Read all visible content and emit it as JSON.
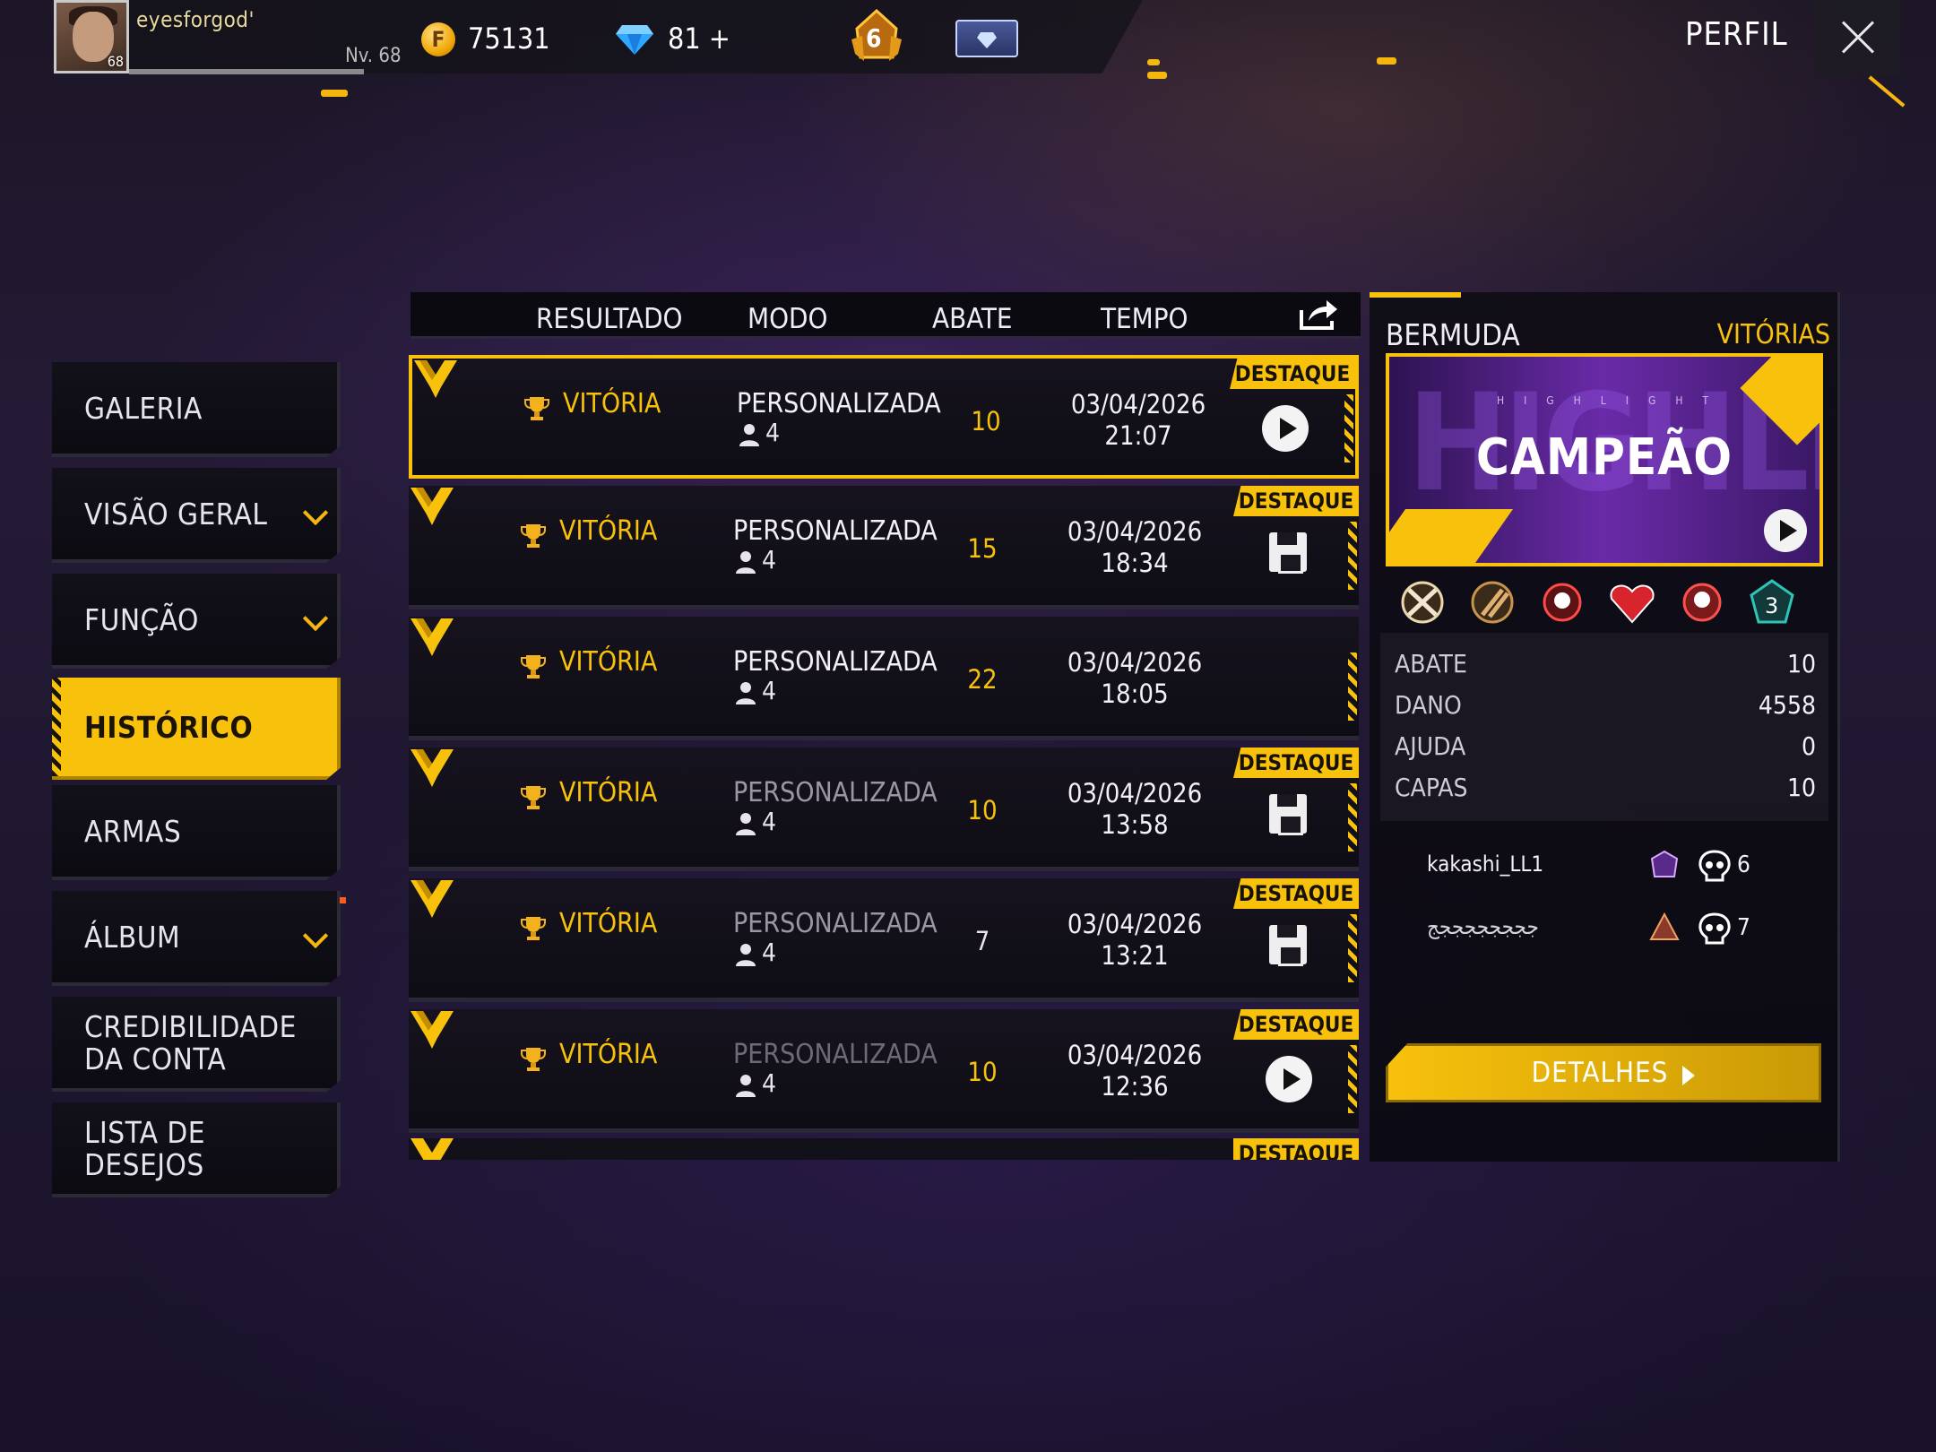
{
  "header": {
    "username": "eyesforgod'",
    "avatar_level": "68",
    "level_label": "Nv. 68",
    "gold_icon": "F",
    "gold": "75131",
    "diamonds": "81",
    "diamonds_plus": "+",
    "rank_number": "6",
    "title": "PERFIL"
  },
  "sidebar": {
    "items": [
      {
        "label": "GALERIA"
      },
      {
        "label": "VISÃO GERAL"
      },
      {
        "label": "FUNÇÃO"
      },
      {
        "label": "HISTÓRICO",
        "active": true
      },
      {
        "label": "ARMAS"
      },
      {
        "label": "ÁLBUM"
      },
      {
        "label": "CREDIBILIDADE DA CONTA"
      },
      {
        "label": "LISTA DE DESEJOS"
      }
    ]
  },
  "table": {
    "columns": [
      "RESULTADO",
      "MODO",
      "ABATE",
      "TEMPO"
    ],
    "rows": [
      {
        "result": "VITÓRIA",
        "mode": "PERSONALIZADA",
        "players": "4",
        "kills": "10",
        "date": "03/04/2026",
        "time": "21:07",
        "badge": "DESTAQUE",
        "action": "play-icon"
      },
      {
        "result": "VITÓRIA",
        "mode": "PERSONALIZADA",
        "players": "4",
        "kills": "15",
        "date": "03/04/2026",
        "time": "18:34",
        "badge": "DESTAQUE",
        "action": "save-icon"
      },
      {
        "result": "VITÓRIA",
        "mode": "PERSONALIZADA",
        "players": "4",
        "kills": "22",
        "date": "03/04/2026",
        "time": "18:05",
        "badge": "",
        "action": ""
      },
      {
        "result": "VITÓRIA",
        "mode": "PERSONALIZADA",
        "players": "4",
        "kills": "10",
        "date": "03/04/2026",
        "time": "13:58",
        "badge": "DESTAQUE",
        "action": "save-icon"
      },
      {
        "result": "VITÓRIA",
        "mode": "PERSONALIZADA",
        "players": "4",
        "kills": "7",
        "date": "03/04/2026",
        "time": "13:21",
        "badge": "DESTAQUE",
        "action": "save-icon"
      },
      {
        "result": "VITÓRIA",
        "mode": "PERSONALIZADA",
        "players": "4",
        "kills": "10",
        "date": "03/04/2026",
        "time": "12:36",
        "badge": "DESTAQUE",
        "action": "play-icon"
      }
    ],
    "partial_row_badge": "DESTAQUE"
  },
  "detail": {
    "map": "BERMUDA",
    "mode": "VITÓRIAS",
    "banner_title": "CAMPEÃO",
    "stats": [
      {
        "label": "ABATE",
        "value": "10"
      },
      {
        "label": "DANO",
        "value": "4558"
      },
      {
        "label": "AJUDA",
        "value": "0"
      },
      {
        "label": "CAPAS",
        "value": "10"
      }
    ],
    "team": [
      {
        "name": "kakashi_LL1",
        "kills": "6"
      },
      {
        "name": "ججججججججج",
        "kills": "7"
      }
    ],
    "details_button": "DETALHES"
  },
  "colors": {
    "accent": "#f8c10c",
    "background": "#1f1730"
  }
}
